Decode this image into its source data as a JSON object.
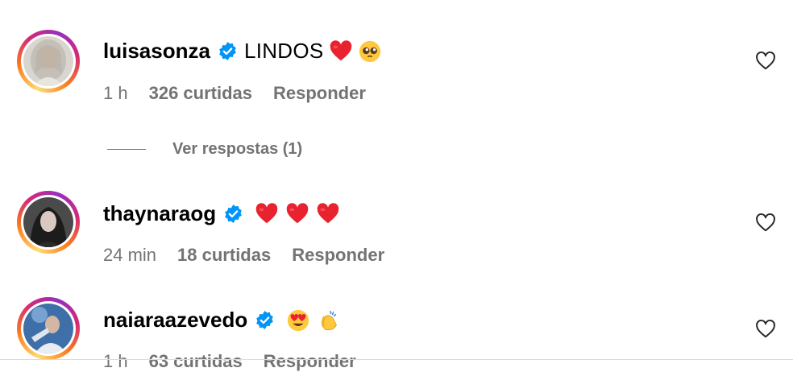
{
  "comments": [
    {
      "username": "luisasonza",
      "text": "LINDOS",
      "emojis": [
        "red-heart-emoji",
        "pleading-face-emoji"
      ],
      "time": "1 h",
      "likes": "326 curtidas",
      "reply": "Responder",
      "verified": true
    },
    {
      "username": "thaynaraog",
      "text": "",
      "emojis": [
        "red-heart-emoji",
        "red-heart-emoji",
        "red-heart-emoji"
      ],
      "time": "24 min",
      "likes": "18 curtidas",
      "reply": "Responder",
      "verified": true
    },
    {
      "username": "naiaraazevedo",
      "text": "",
      "emojis": [
        "heart-eyes-emoji",
        "clapping-hands-emoji"
      ],
      "time": "1 h",
      "likes": "63 curtidas",
      "reply": "Responder",
      "verified": true
    }
  ],
  "view_replies": {
    "label": "Ver respostas (1)"
  },
  "colors": {
    "verified_blue": "#0095f6",
    "meta_gray": "#737373",
    "heart_red": "#e8232f"
  },
  "icons": {
    "like": "heart-outline-icon",
    "verified": "verified-badge-icon"
  }
}
